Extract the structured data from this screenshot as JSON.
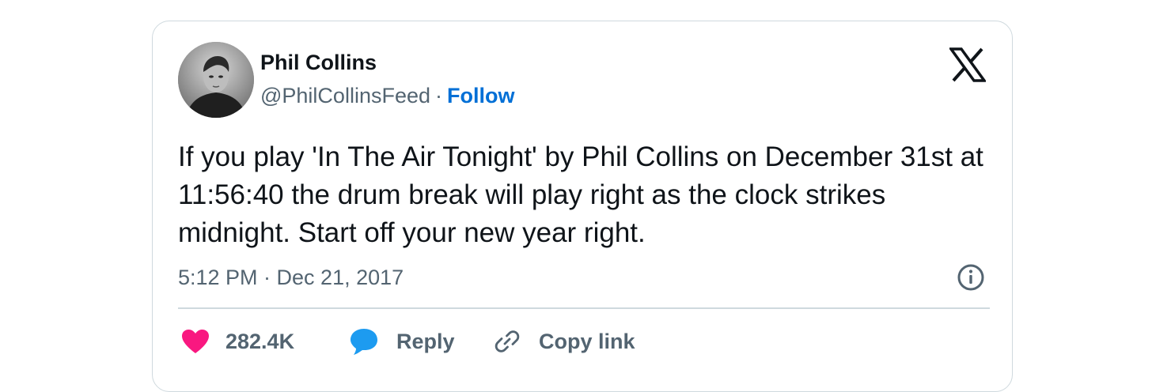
{
  "author": {
    "name": "Phil Collins",
    "handle": "@PhilCollinsFeed",
    "separator": "·",
    "follow_label": "Follow",
    "avatar_icon": "avatar-photo"
  },
  "platform_logo": "x-logo-icon",
  "tweet": {
    "text": "If you play 'In The Air Tonight' by Phil Collins on December 31st at 11:56:40 the drum break will play right as the clock strikes midnight. Start off your new year right.",
    "timestamp": "5:12 PM · Dec 21, 2017"
  },
  "actions": {
    "like_count": "282.4K",
    "reply_label": "Reply",
    "copy_link_label": "Copy link"
  },
  "colors": {
    "text": "#0f1419",
    "secondary": "#536471",
    "follow": "#006fd6",
    "like": "#f91880",
    "reply": "#1d9bf0",
    "border": "#cfd9de"
  }
}
